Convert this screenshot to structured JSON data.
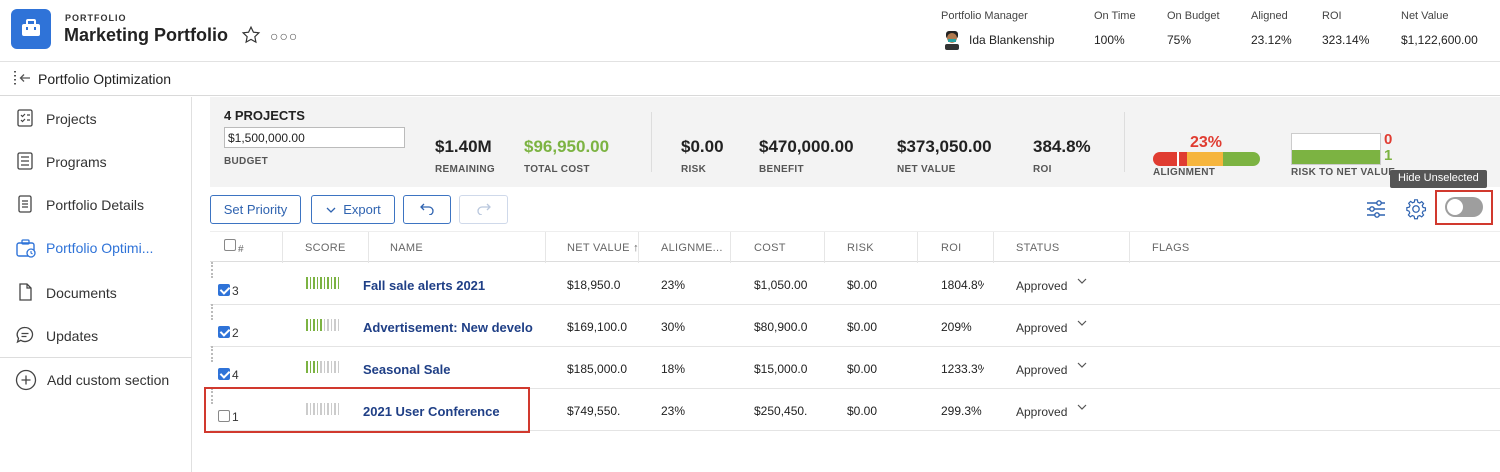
{
  "header": {
    "eyebrow": "PORTFOLIO",
    "title": "Marketing Portfolio",
    "metrics": [
      {
        "label": "Portfolio Manager",
        "value": "Ida Blankenship"
      },
      {
        "label": "On Time",
        "value": "100%"
      },
      {
        "label": "On Budget",
        "value": "75%"
      },
      {
        "label": "Aligned",
        "value": "23.12%"
      },
      {
        "label": "ROI",
        "value": "323.14%"
      },
      {
        "label": "Net Value",
        "value": "$1,122,600.00"
      }
    ]
  },
  "subbar": {
    "title": "Portfolio Optimization"
  },
  "sidebar": {
    "items": [
      {
        "label": "Projects",
        "icon": "projects-icon"
      },
      {
        "label": "Programs",
        "icon": "programs-icon"
      },
      {
        "label": "Portfolio Details",
        "icon": "details-icon"
      },
      {
        "label": "Portfolio Optimi...",
        "icon": "optimization-icon",
        "active": true
      },
      {
        "label": "Documents",
        "icon": "document-icon"
      },
      {
        "label": "Updates",
        "icon": "updates-icon"
      },
      {
        "label": "Add custom section",
        "icon": "add-icon"
      }
    ]
  },
  "summary": {
    "project_count": "4 PROJECTS",
    "budget_value": "$1,500,000.00",
    "budget_label": "BUDGET",
    "remaining_value": "$1.40M",
    "remaining_label": "REMAINING",
    "total_cost_value": "$96,950.00",
    "total_cost_label": "TOTAL COST",
    "risk_value": "$0.00",
    "risk_label": "RISK",
    "benefit_value": "$470,000.00",
    "benefit_label": "BENEFIT",
    "net_value_value": "$373,050.00",
    "net_value_label": "NET VALUE",
    "roi_value": "384.8%",
    "roi_label": "ROI",
    "alignment_pct": "23%",
    "alignment_label": "ALIGNMENT",
    "risk_to_nv_red": "0",
    "risk_to_nv_green": "1",
    "risk_to_nv_label": "RISK TO NET VALUE",
    "colors": {
      "red": "#e03c31",
      "orange": "#f6b53d",
      "green": "#7cb342"
    }
  },
  "toolbar": {
    "set_priority": "Set Priority",
    "export": "Export",
    "tooltip": "Hide Unselected",
    "hide_unselected": false
  },
  "table": {
    "columns": {
      "num": "#",
      "score": "SCORE",
      "name": "NAME",
      "net_value": "NET VALUE",
      "alignment": "ALIGNME...",
      "cost": "COST",
      "risk": "RISK",
      "roi": "ROI",
      "status": "STATUS",
      "flags": "FLAGS"
    },
    "rows": [
      {
        "checked": true,
        "num": "3",
        "score": 10,
        "name": "Fall sale alerts 2021",
        "net_value": "$18,950.0",
        "alignment": "23%",
        "cost": "$1,050.00",
        "risk": "$0.00",
        "roi": "1804.8%",
        "status": "Approved"
      },
      {
        "checked": true,
        "num": "2",
        "score": 5,
        "name": "Advertisement: New developme",
        "net_value": "$169,100.0",
        "alignment": "30%",
        "cost": "$80,900.0",
        "risk": "$0.00",
        "roi": "209%",
        "status": "Approved"
      },
      {
        "checked": true,
        "num": "4",
        "score": 4,
        "name": "Seasonal Sale",
        "net_value": "$185,000.0",
        "alignment": "18%",
        "cost": "$15,000.0",
        "risk": "$0.00",
        "roi": "1233.3%",
        "status": "Approved"
      },
      {
        "checked": false,
        "num": "1",
        "score": 0,
        "name": "2021 User Conference",
        "net_value": "$749,550.",
        "alignment": "23%",
        "cost": "$250,450.",
        "risk": "$0.00",
        "roi": "299.3%",
        "status": "Approved"
      }
    ]
  }
}
